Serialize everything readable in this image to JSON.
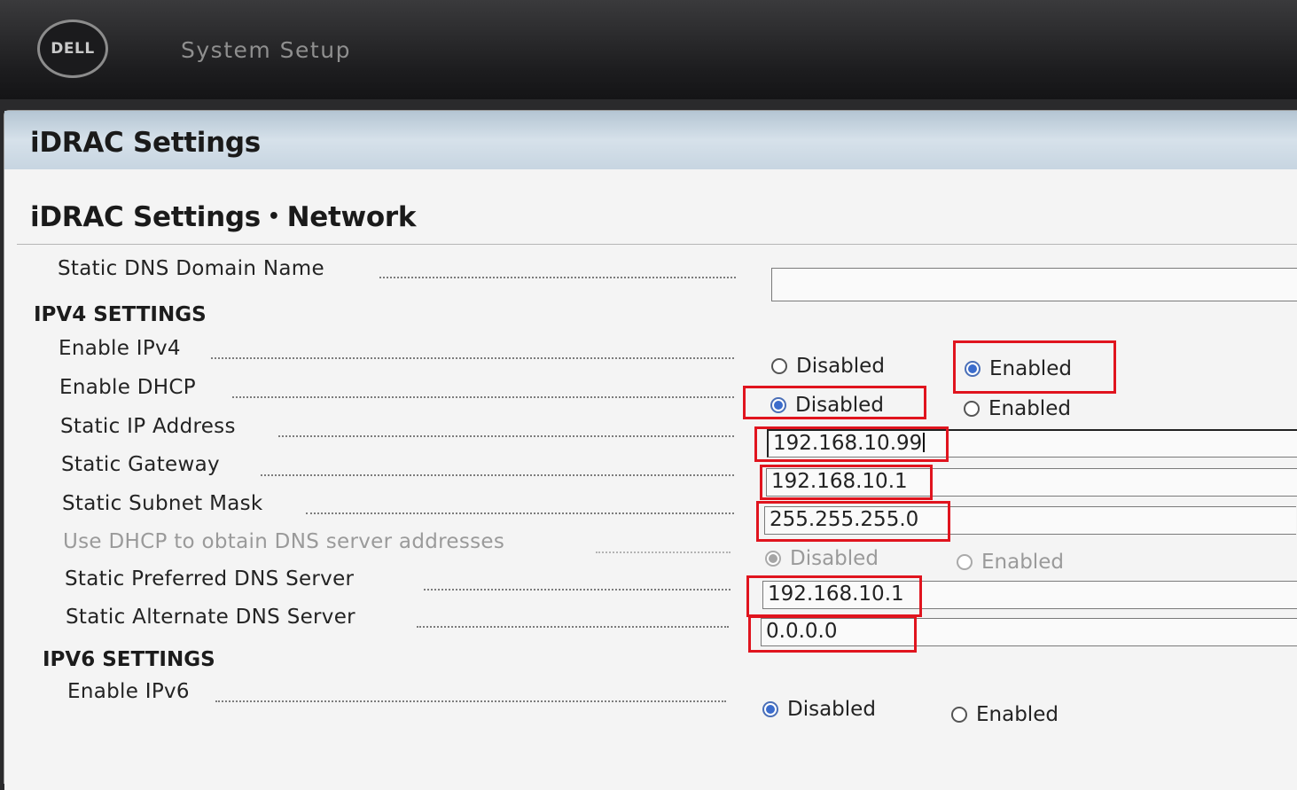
{
  "header": {
    "logo_text": "DELL",
    "title": "System Setup"
  },
  "panel": {
    "title": "iDRAC Settings"
  },
  "breadcrumb": {
    "parent": "iDRAC Settings",
    "separator": "•",
    "current": "Network"
  },
  "fields": {
    "dns_domain_name": {
      "label": "Static DNS Domain Name",
      "value": ""
    },
    "ipv4_section": "IPV4 SETTINGS",
    "enable_ipv4": {
      "label": "Enable IPv4",
      "opt_disabled": "Disabled",
      "opt_enabled": "Enabled",
      "selected": "Enabled"
    },
    "enable_dhcp": {
      "label": "Enable DHCP",
      "opt_disabled": "Disabled",
      "opt_enabled": "Enabled",
      "selected": "Disabled"
    },
    "static_ip": {
      "label": "Static IP Address",
      "value": "192.168.10.99"
    },
    "static_gateway": {
      "label": "Static Gateway",
      "value": "192.168.10.1"
    },
    "subnet_mask": {
      "label": "Static Subnet Mask",
      "value": "255.255.255.0"
    },
    "dhcp_dns": {
      "label": "Use DHCP to obtain DNS server addresses",
      "opt_disabled": "Disabled",
      "opt_enabled": "Enabled",
      "selected": "Disabled"
    },
    "preferred_dns": {
      "label": "Static Preferred DNS Server",
      "value": "192.168.10.1"
    },
    "alternate_dns": {
      "label": "Static Alternate DNS Server",
      "value": "0.0.0.0"
    },
    "ipv6_section": "IPV6 SETTINGS",
    "enable_ipv6": {
      "label": "Enable IPv6",
      "opt_disabled": "Disabled",
      "opt_enabled": "Enabled",
      "selected": "Disabled"
    }
  },
  "colors": {
    "highlight": "#e0141e",
    "radio_selected": "#3b6ccc",
    "header_bg": "#1d1d1f",
    "panel_header": "#c7d5e1"
  }
}
